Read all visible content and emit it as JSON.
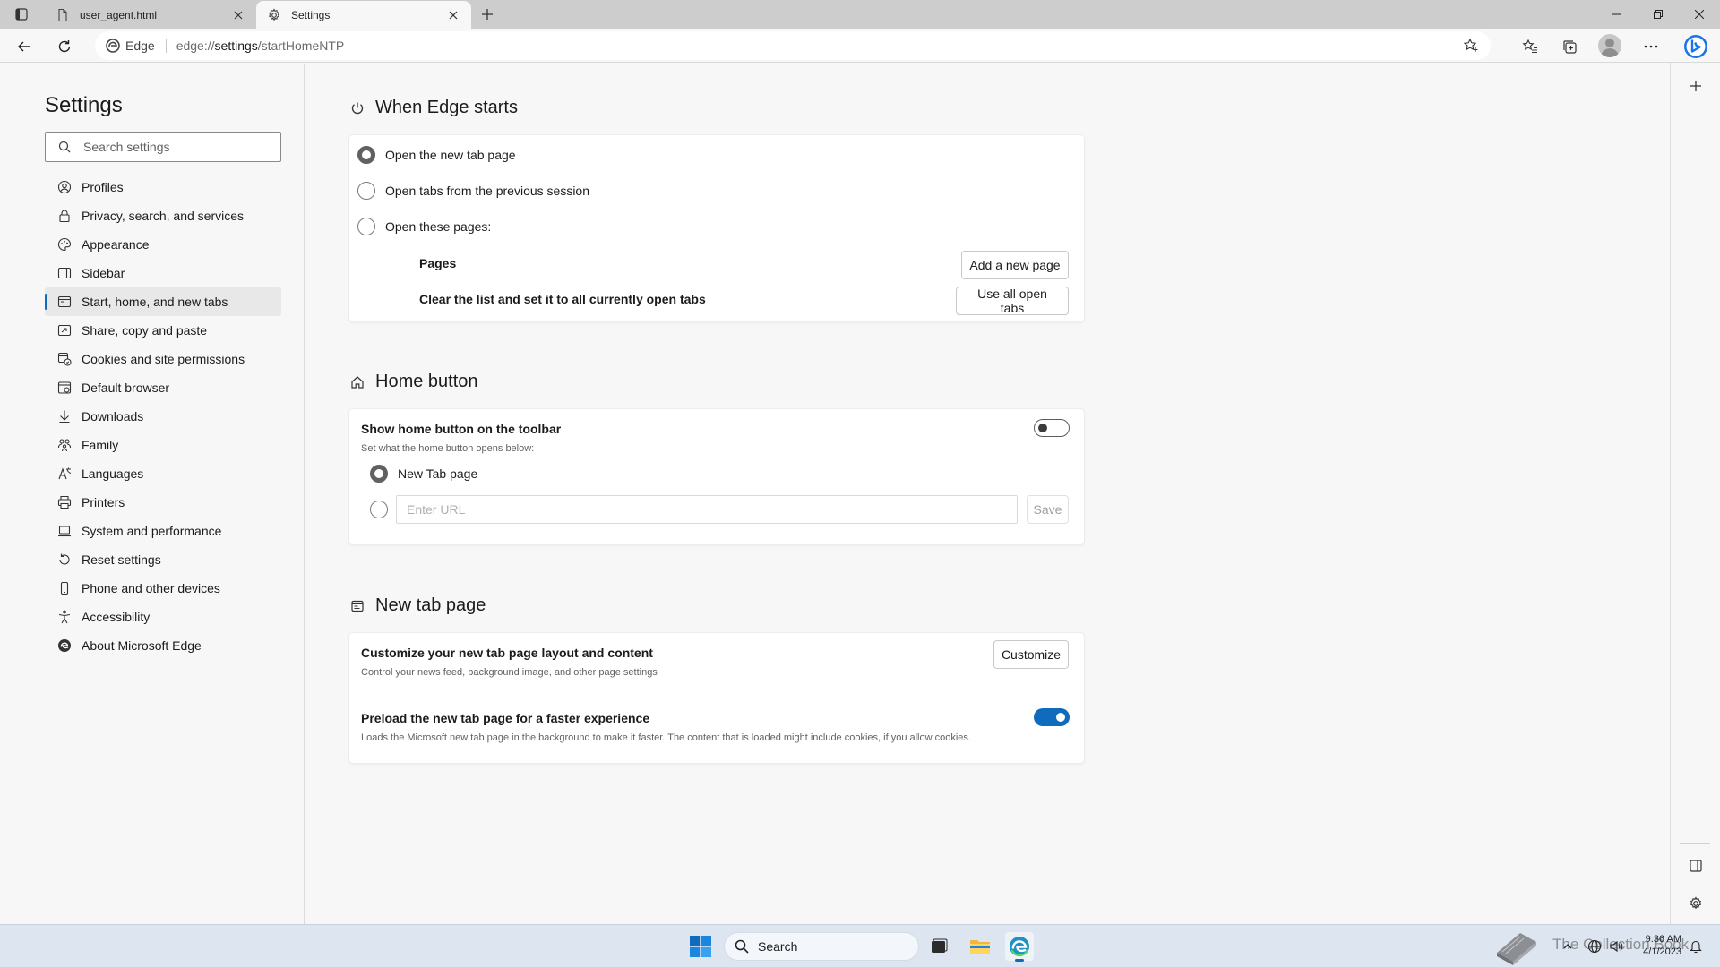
{
  "browser": {
    "tabs": [
      {
        "title": "user_agent.html",
        "icon": "file-icon",
        "active": false
      },
      {
        "title": "Settings",
        "icon": "gear-icon",
        "active": true
      }
    ],
    "address": {
      "chip": "Edge",
      "url_prefix": "edge://",
      "url_host": "settings",
      "url_path": "/startHomeNTP"
    },
    "window_controls": [
      "minimize",
      "restore",
      "close"
    ]
  },
  "nav": {
    "title": "Settings",
    "search_placeholder": "Search settings",
    "items": [
      {
        "label": "Profiles",
        "icon": "profile-icon"
      },
      {
        "label": "Privacy, search, and services",
        "icon": "lock-icon"
      },
      {
        "label": "Appearance",
        "icon": "palette-icon"
      },
      {
        "label": "Sidebar",
        "icon": "sidebar-icon"
      },
      {
        "label": "Start, home, and new tabs",
        "icon": "home-tabs-icon",
        "active": true
      },
      {
        "label": "Share, copy and paste",
        "icon": "share-icon"
      },
      {
        "label": "Cookies and site permissions",
        "icon": "cookies-icon"
      },
      {
        "label": "Default browser",
        "icon": "browser-icon"
      },
      {
        "label": "Downloads",
        "icon": "download-icon"
      },
      {
        "label": "Family",
        "icon": "family-icon"
      },
      {
        "label": "Languages",
        "icon": "languages-icon"
      },
      {
        "label": "Printers",
        "icon": "printer-icon"
      },
      {
        "label": "System and performance",
        "icon": "laptop-icon"
      },
      {
        "label": "Reset settings",
        "icon": "reset-icon"
      },
      {
        "label": "Phone and other devices",
        "icon": "phone-icon"
      },
      {
        "label": "Accessibility",
        "icon": "accessibility-icon"
      },
      {
        "label": "About Microsoft Edge",
        "icon": "edge-logo-icon"
      }
    ]
  },
  "when_edge_starts": {
    "title": "When Edge starts",
    "options": [
      {
        "label": "Open the new tab page",
        "checked": true
      },
      {
        "label": "Open tabs from the previous session",
        "checked": false
      },
      {
        "label": "Open these pages:",
        "checked": false
      }
    ],
    "pages_label": "Pages",
    "add_page_button": "Add a new page",
    "clear_list_label": "Clear the list and set it to all currently open tabs",
    "use_all_tabs_button": "Use all open tabs"
  },
  "home_button": {
    "title": "Home button",
    "toggle_label": "Show home button on the toolbar",
    "toggle_on": false,
    "description": "Set what the home button opens below:",
    "option_new_tab": "New Tab page",
    "url_placeholder": "Enter URL",
    "save_button": "Save"
  },
  "new_tab_page": {
    "title": "New tab page",
    "customize_label": "Customize your new tab page layout and content",
    "customize_desc": "Control your news feed, background image, and other page settings",
    "customize_button": "Customize",
    "preload_label": "Preload the new tab page for a faster experience",
    "preload_desc": "Loads the Microsoft new tab page in the background to make it faster. The content that is loaded might include cookies, if you allow cookies.",
    "preload_on": true
  },
  "taskbar": {
    "search_label": "Search",
    "apps": [
      "task-view-icon",
      "file-explorer-icon",
      "edge-icon"
    ],
    "watermark_text": "The Collection Book",
    "time": "9:36 AM",
    "date": "4/1/2023"
  },
  "colors": {
    "accent": "#0f6cbd",
    "tabstrip": "#cdcdcd",
    "background": "#f7f7f7",
    "taskbar": "#dde6f0"
  }
}
